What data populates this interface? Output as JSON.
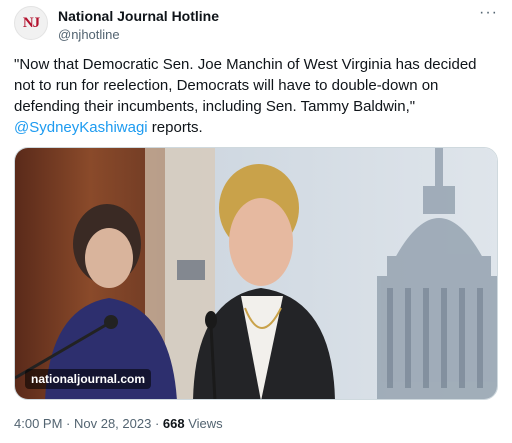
{
  "account": {
    "avatar_text": "NJ",
    "display_name": "National Journal Hotline",
    "handle": "@njhotline"
  },
  "menu": {
    "more_label": "···"
  },
  "tweet": {
    "text_before": "\"Now that Democratic Sen. Joe Manchin of West Virginia has decided not to run for reelection, Democrats will have to double-down on defending their incumbents, including Sen. Tammy Baldwin,\"",
    "mention": "@SydneyKashiwagi",
    "text_after": " reports."
  },
  "media": {
    "source_label": "nationaljournal.com"
  },
  "meta": {
    "time": "4:00 PM",
    "separator": " · ",
    "date": "Nov 28, 2023",
    "views_count": "668",
    "views_label": " Views"
  },
  "colors": {
    "accent": "#1d9bf0",
    "secondary_text": "#536471",
    "logo_red": "#b3122e"
  }
}
